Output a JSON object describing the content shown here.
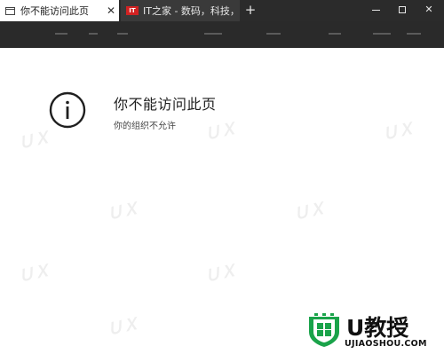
{
  "browser": {
    "tabs": [
      {
        "title": "你不能访问此页",
        "close": "✕",
        "active": true
      },
      {
        "favicon_text": "IT",
        "title": "IT之家 - 数码，科技，生活",
        "active": false
      }
    ],
    "new_tab_label": "+",
    "window_controls": {
      "close": "✕"
    }
  },
  "page": {
    "icon": "info-circle-icon",
    "title": "你不能访问此页",
    "subtitle": "你的组织不允许"
  },
  "logo": {
    "brand": "U教授",
    "domain": "UJIAOSHOU.COM"
  },
  "colors": {
    "titlebar": "#2b2b2b",
    "addressbar": "#2a2a2a",
    "logo_green": "#1aa34a",
    "ithome_red": "#d22222"
  }
}
